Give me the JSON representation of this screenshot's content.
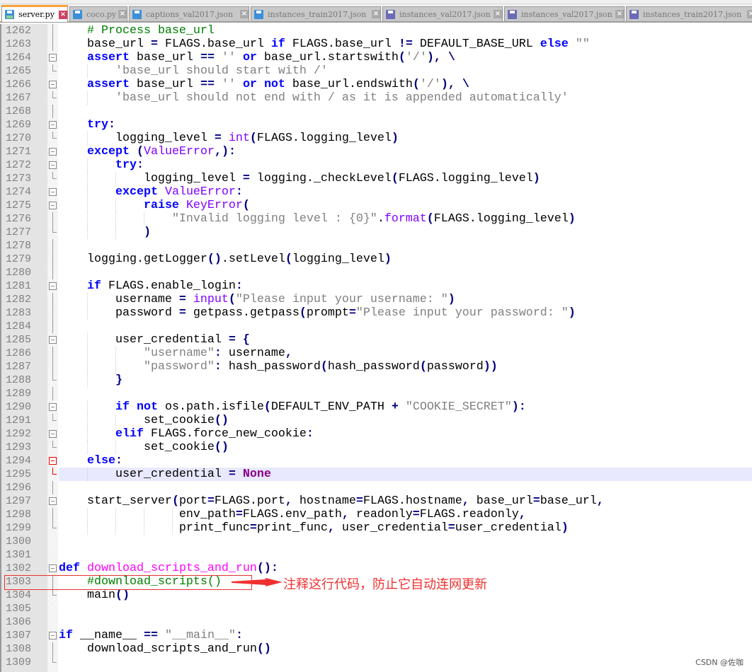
{
  "tabs": [
    {
      "label": "server.py",
      "active": true,
      "style": "blue"
    },
    {
      "label": "coco.py",
      "style": "blue"
    },
    {
      "label": "captions_val2017.json",
      "style": "blue"
    },
    {
      "label": "instances_train2017.json",
      "style": "blue"
    },
    {
      "label": "instances_val2017.json",
      "style": "purple"
    },
    {
      "label": "instances_val2017.json",
      "style": "purple"
    },
    {
      "label": "instances_train2017.json",
      "style": "purple"
    }
  ],
  "editor": {
    "highlighted_line": 1295,
    "lines": [
      {
        "n": 1262,
        "t": "    # Process base_url",
        "f": "line"
      },
      {
        "n": 1263,
        "t": "    base_url = FLAGS.base_url if FLAGS.base_url != DEFAULT_BASE_URL else \"\"",
        "f": "line"
      },
      {
        "n": 1264,
        "t": "    assert base_url == '' or base_url.startswith('/'), \\",
        "f": "open"
      },
      {
        "n": 1265,
        "t": "        'base_url should start with /'",
        "f": "end"
      },
      {
        "n": 1266,
        "t": "    assert base_url == '' or not base_url.endswith('/'), \\",
        "f": "open"
      },
      {
        "n": 1267,
        "t": "        'base_url should not end with / as it is appended automatically'",
        "f": "end"
      },
      {
        "n": 1268,
        "t": "",
        "f": "line"
      },
      {
        "n": 1269,
        "t": "    try:",
        "f": "open"
      },
      {
        "n": 1270,
        "t": "        logging_level = int(FLAGS.logging_level)",
        "f": "end"
      },
      {
        "n": 1271,
        "t": "    except (ValueError,):",
        "f": "open"
      },
      {
        "n": 1272,
        "t": "        try:",
        "f": "open"
      },
      {
        "n": 1273,
        "t": "            logging_level = logging._checkLevel(FLAGS.logging_level)",
        "f": "end"
      },
      {
        "n": 1274,
        "t": "        except ValueError:",
        "f": "open"
      },
      {
        "n": 1275,
        "t": "            raise KeyError(",
        "f": "open"
      },
      {
        "n": 1276,
        "t": "                \"Invalid logging level : {0}\".format(FLAGS.logging_level)",
        "f": "line"
      },
      {
        "n": 1277,
        "t": "            )",
        "f": "end"
      },
      {
        "n": 1278,
        "t": "",
        "f": "line"
      },
      {
        "n": 1279,
        "t": "    logging.getLogger().setLevel(logging_level)",
        "f": "line"
      },
      {
        "n": 1280,
        "t": "",
        "f": "line"
      },
      {
        "n": 1281,
        "t": "    if FLAGS.enable_login:",
        "f": "open"
      },
      {
        "n": 1282,
        "t": "        username = input(\"Please input your username: \")",
        "f": "line"
      },
      {
        "n": 1283,
        "t": "        password = getpass.getpass(prompt=\"Please input your password: \")",
        "f": "line"
      },
      {
        "n": 1284,
        "t": "",
        "f": "line"
      },
      {
        "n": 1285,
        "t": "        user_credential = {",
        "f": "open"
      },
      {
        "n": 1286,
        "t": "            \"username\": username,",
        "f": "line"
      },
      {
        "n": 1287,
        "t": "            \"password\": hash_password(hash_password(password))",
        "f": "line"
      },
      {
        "n": 1288,
        "t": "        }",
        "f": "end"
      },
      {
        "n": 1289,
        "t": "",
        "f": "line"
      },
      {
        "n": 1290,
        "t": "        if not os.path.isfile(DEFAULT_ENV_PATH + \"COOKIE_SECRET\"):",
        "f": "open"
      },
      {
        "n": 1291,
        "t": "            set_cookie()",
        "f": "end"
      },
      {
        "n": 1292,
        "t": "        elif FLAGS.force_new_cookie:",
        "f": "open"
      },
      {
        "n": 1293,
        "t": "            set_cookie()",
        "f": "end"
      },
      {
        "n": 1294,
        "t": "    else:",
        "f": "open-red"
      },
      {
        "n": 1295,
        "t": "        user_credential = None",
        "f": "end-red"
      },
      {
        "n": 1296,
        "t": "",
        "f": "line"
      },
      {
        "n": 1297,
        "t": "    start_server(port=FLAGS.port, hostname=FLAGS.hostname, base_url=base_url,",
        "f": "open"
      },
      {
        "n": 1298,
        "t": "                 env_path=FLAGS.env_path, readonly=FLAGS.readonly,",
        "f": "line"
      },
      {
        "n": 1299,
        "t": "                 print_func=print_func, user_credential=user_credential)",
        "f": "end"
      },
      {
        "n": 1300,
        "t": "",
        "f": ""
      },
      {
        "n": 1301,
        "t": "",
        "f": ""
      },
      {
        "n": 1302,
        "t": "def download_scripts_and_run():",
        "f": "open"
      },
      {
        "n": 1303,
        "t": "    #download_scripts()",
        "f": "line"
      },
      {
        "n": 1304,
        "t": "    main()",
        "f": "end"
      },
      {
        "n": 1305,
        "t": "",
        "f": ""
      },
      {
        "n": 1306,
        "t": "",
        "f": ""
      },
      {
        "n": 1307,
        "t": "if __name__ == \"__main__\":",
        "f": "open"
      },
      {
        "n": 1308,
        "t": "    download_scripts_and_run()",
        "f": "line"
      },
      {
        "n": 1309,
        "t": "",
        "f": "end"
      }
    ]
  },
  "annotation": {
    "text": "注释这行代码，防止它自动连网更新",
    "color": "#f03030"
  },
  "watermark": "CSDN @佐咖"
}
